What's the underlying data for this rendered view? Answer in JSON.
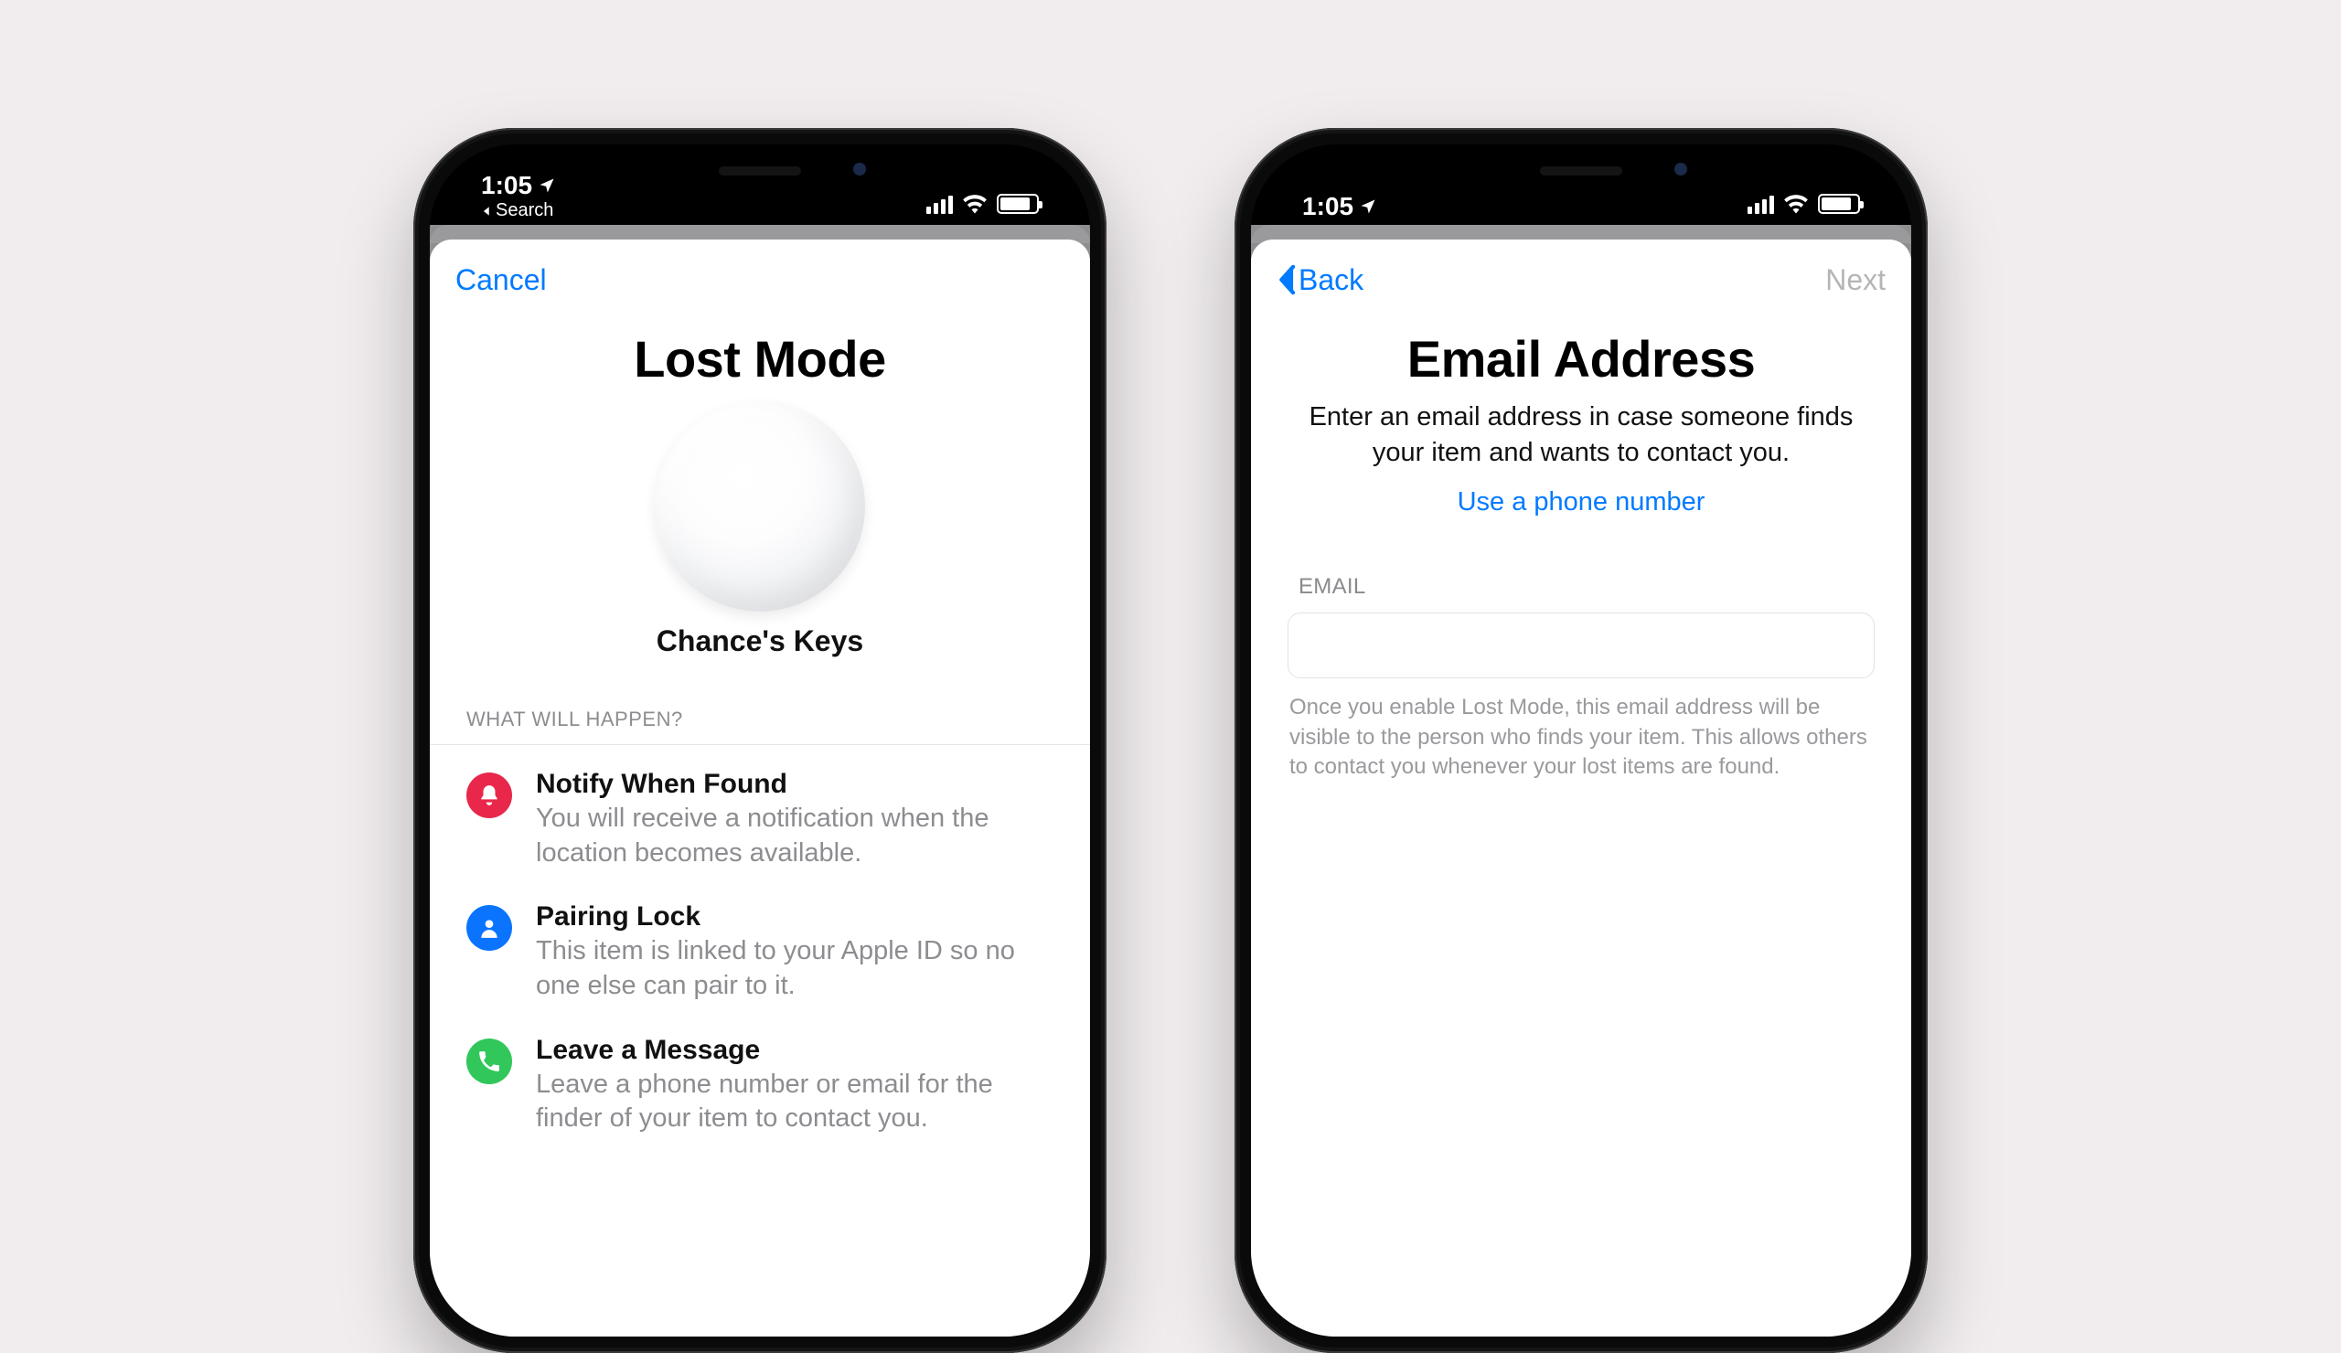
{
  "status": {
    "time": "1:05",
    "back_label": "Search"
  },
  "left": {
    "cancel": "Cancel",
    "title": "Lost Mode",
    "item_name": "Chance's Keys",
    "section_header": "WHAT WILL HAPPEN?",
    "bullets": [
      {
        "title": "Notify When Found",
        "desc": "You will receive a notification when the location becomes available."
      },
      {
        "title": "Pairing Lock",
        "desc": "This item is linked to your Apple ID so no one else can pair to it."
      },
      {
        "title": "Leave a Message",
        "desc": "Leave a phone number or email for the finder of your item to contact you."
      }
    ]
  },
  "right": {
    "back": "Back",
    "next": "Next",
    "title": "Email Address",
    "subtext": "Enter an email address in case someone finds your item and wants to contact you.",
    "alt_link": "Use a phone number",
    "field_label": "EMAIL",
    "email_value": "",
    "hint": "Once you enable Lost Mode, this email address will be visible to the person who finds your item. This allows others to contact you whenever your lost items are found."
  }
}
